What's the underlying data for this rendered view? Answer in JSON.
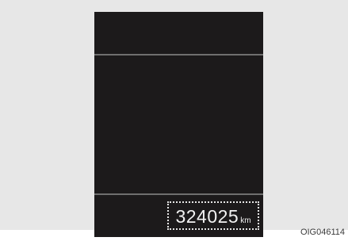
{
  "odometer": {
    "value": "324025",
    "unit": "km"
  },
  "figure": {
    "code": "OIG046114"
  },
  "colors": {
    "backdrop": "#e7e7e7",
    "display": "#1c1a1b",
    "divider": "#6f6f6f",
    "text": "#f2f2f2"
  }
}
